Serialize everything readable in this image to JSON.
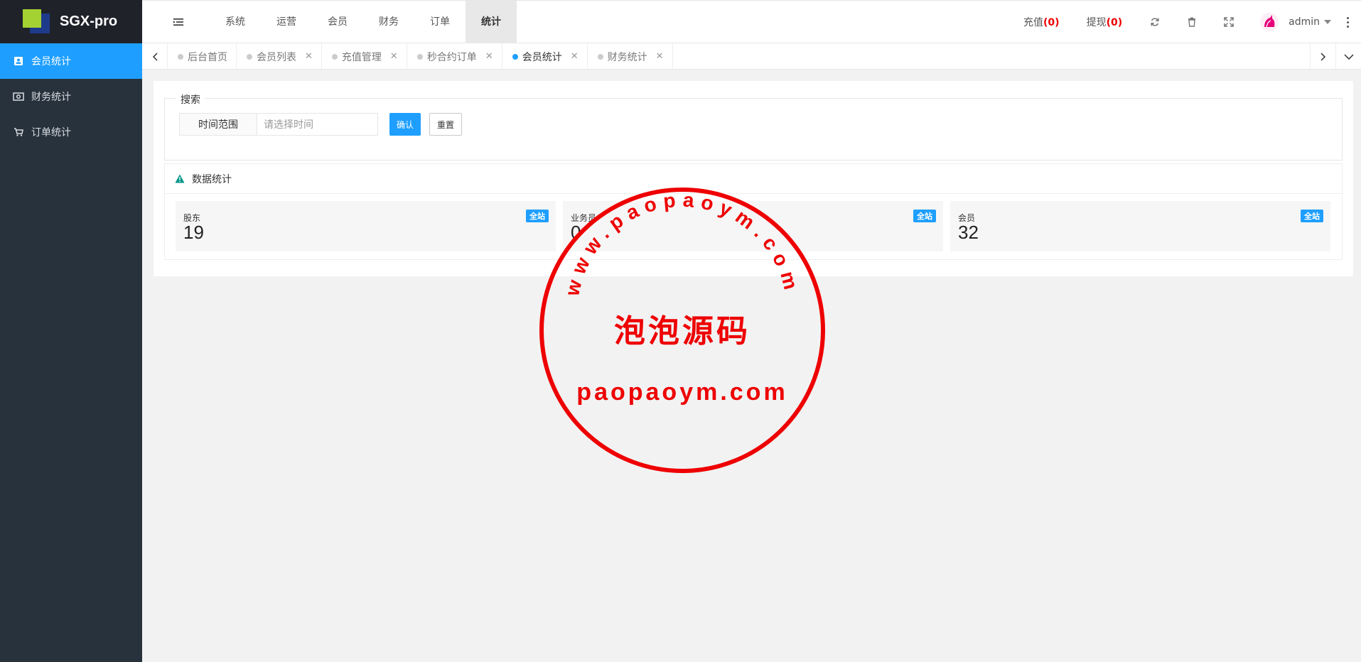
{
  "app": {
    "title": "SGX-pro"
  },
  "sidebar": {
    "items": [
      {
        "label": "会员统计",
        "icon": "member-card-icon",
        "active": true
      },
      {
        "label": "财务统计",
        "icon": "money-icon",
        "active": false
      },
      {
        "label": "订单统计",
        "icon": "cart-icon",
        "active": false
      }
    ]
  },
  "header": {
    "nav": [
      "系统",
      "运营",
      "会员",
      "财务",
      "订单",
      "统计"
    ],
    "active_nav": "统计",
    "recharge_label": "充值",
    "recharge_count": "(0)",
    "withdraw_label": "提现",
    "withdraw_count": "(0)",
    "user_name": "admin"
  },
  "tabs": [
    {
      "label": "后台首页",
      "closable": false,
      "active": false
    },
    {
      "label": "会员列表",
      "closable": true,
      "active": false
    },
    {
      "label": "充值管理",
      "closable": true,
      "active": false
    },
    {
      "label": "秒合约订单",
      "closable": true,
      "active": false
    },
    {
      "label": "会员统计",
      "closable": true,
      "active": true
    },
    {
      "label": "财务统计",
      "closable": true,
      "active": false
    }
  ],
  "search": {
    "legend": "搜索",
    "time_range_label": "时间范围",
    "time_placeholder": "请选择时间",
    "confirm_label": "确认",
    "reset_label": "重置"
  },
  "stats_card": {
    "title": "数据统计",
    "items": [
      {
        "label": "股东",
        "value": "19",
        "badge": "全站"
      },
      {
        "label": "业务员",
        "value": "0",
        "badge": "全站"
      },
      {
        "label": "会员",
        "value": "32",
        "badge": "全站"
      }
    ]
  },
  "watermark": {
    "top_arc": "www.paopaoym.com",
    "center": "泡泡源码",
    "bottom": "paopaoym.com"
  },
  "colors": {
    "sidebar_bg": "#28323d",
    "logo_bg": "#20222a",
    "accent": "#1e9fff",
    "alert": "#e00000",
    "stamp": "#ee0000"
  }
}
